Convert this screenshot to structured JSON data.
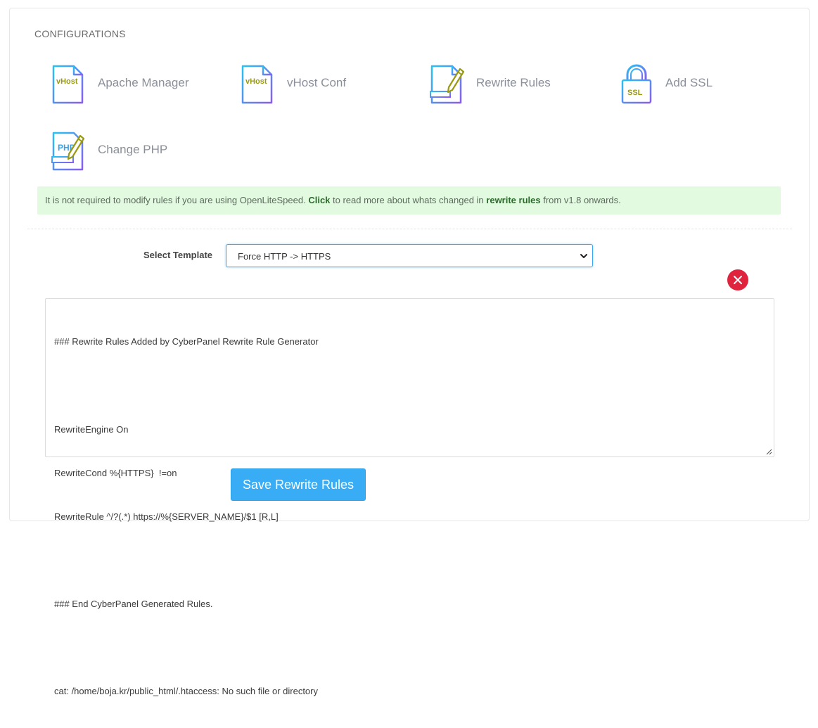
{
  "section": {
    "title": "CONFIGURATIONS"
  },
  "config_items": [
    {
      "label": "Apache Manager",
      "icon": "vhost-file-icon",
      "icon_text": "vHost"
    },
    {
      "label": "vHost Conf",
      "icon": "vhost-file-icon",
      "icon_text": "vHost"
    },
    {
      "label": "Rewrite Rules",
      "icon": "rewrite-rules-icon"
    },
    {
      "label": "Add SSL",
      "icon": "ssl-lock-icon",
      "icon_text": "SSL"
    },
    {
      "label": "Change PHP",
      "icon": "php-file-icon",
      "icon_text": "PHP"
    }
  ],
  "alert": {
    "text_1": "It is not required to modify rules if you are using OpenLiteSpeed. ",
    "link_click": "Click",
    "text_2": " to read more about whats changed in ",
    "link_rewrite": "rewrite rules",
    "text_3": " from v1.8 onwards."
  },
  "template": {
    "label": "Select Template",
    "selected": "Force HTTP -> HTTPS"
  },
  "editor": {
    "lines": [
      "### Rewrite Rules Added by CyberPanel Rewrite Rule Generator",
      "",
      "RewriteEngine On",
      "RewriteCond %{HTTPS}  !=on",
      "RewriteRule ^/?(.*) https://%{SERVER_NAME}/$1 [R,L]",
      "",
      "### End CyberPanel Generated Rules.",
      "",
      "cat: /home/boja.kr/public_html/.htaccess: No such file or directory"
    ]
  },
  "actions": {
    "save_label": "Save Rewrite Rules"
  },
  "colors": {
    "accent_blue": "#38adf6",
    "alert_bg": "#e2fbe0",
    "danger_red": "#e0243d",
    "icon_text_olive": "#9a9a10"
  }
}
